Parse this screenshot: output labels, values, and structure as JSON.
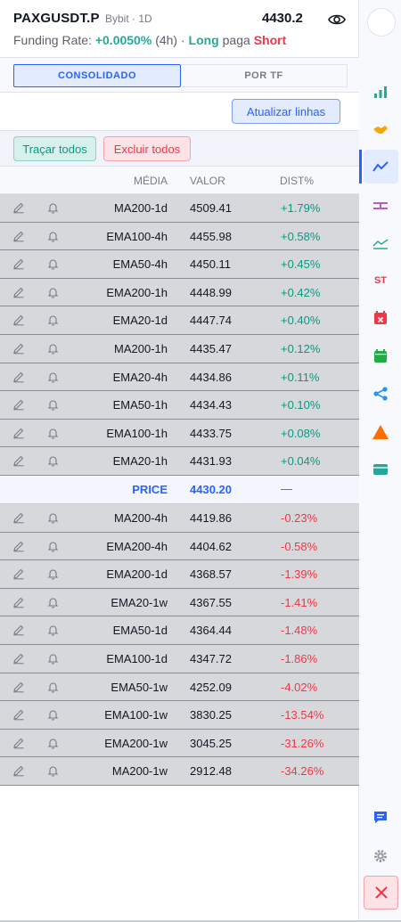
{
  "header": {
    "symbol": "PAXGUSDT.P",
    "exchange": "Bybit · 1D",
    "price": "4430.2",
    "funding_label": "Funding Rate:",
    "funding_rate": "+0.0050%",
    "funding_period": "(4h) ·",
    "long": "Long",
    "paga": "paga",
    "short": "Short"
  },
  "tabs": [
    {
      "label": "CONSOLIDADO",
      "active": true
    },
    {
      "label": "POR TF",
      "active": false
    }
  ],
  "buttons": {
    "update": "Atualizar linhas",
    "trace_all": "Traçar todos",
    "delete_all": "Excluir todos"
  },
  "table": {
    "headers": {
      "media": "MÉDIA",
      "valor": "VALOR",
      "dist": "DIST%"
    },
    "above": [
      {
        "name": "MA200-1d",
        "value": "4509.41",
        "dist": "+1.79%"
      },
      {
        "name": "EMA100-4h",
        "value": "4455.98",
        "dist": "+0.58%"
      },
      {
        "name": "EMA50-4h",
        "value": "4450.11",
        "dist": "+0.45%"
      },
      {
        "name": "EMA200-1h",
        "value": "4448.99",
        "dist": "+0.42%"
      },
      {
        "name": "EMA20-1d",
        "value": "4447.74",
        "dist": "+0.40%"
      },
      {
        "name": "MA200-1h",
        "value": "4435.47",
        "dist": "+0.12%"
      },
      {
        "name": "EMA20-4h",
        "value": "4434.86",
        "dist": "+0.11%"
      },
      {
        "name": "EMA50-1h",
        "value": "4434.43",
        "dist": "+0.10%"
      },
      {
        "name": "EMA100-1h",
        "value": "4433.75",
        "dist": "+0.08%"
      },
      {
        "name": "EMA20-1h",
        "value": "4431.93",
        "dist": "+0.04%"
      }
    ],
    "price_row": {
      "name": "PRICE",
      "value": "4430.20",
      "dist": "—"
    },
    "below": [
      {
        "name": "MA200-4h",
        "value": "4419.86",
        "dist": "-0.23%"
      },
      {
        "name": "EMA200-4h",
        "value": "4404.62",
        "dist": "-0.58%"
      },
      {
        "name": "EMA200-1d",
        "value": "4368.57",
        "dist": "-1.39%"
      },
      {
        "name": "EMA20-1w",
        "value": "4367.55",
        "dist": "-1.41%"
      },
      {
        "name": "EMA50-1d",
        "value": "4364.44",
        "dist": "-1.48%"
      },
      {
        "name": "EMA100-1d",
        "value": "4347.72",
        "dist": "-1.86%"
      },
      {
        "name": "EMA50-1w",
        "value": "4252.09",
        "dist": "-4.02%"
      },
      {
        "name": "EMA100-1w",
        "value": "3830.25",
        "dist": "-13.54%"
      },
      {
        "name": "EMA200-1w",
        "value": "3045.25",
        "dist": "-31.26%"
      },
      {
        "name": "MA200-1w",
        "value": "2912.48",
        "dist": "-34.26%"
      }
    ]
  },
  "rail": {
    "st_label": "ST",
    "icons": [
      "bar-chart-icon",
      "handshake-icon",
      "trend-line-icon",
      "horizontal-line-icon",
      "moving-average-icon",
      "st-icon",
      "calendar-x-icon",
      "calendar-icon",
      "share-icon",
      "warning-triangle-icon",
      "card-icon",
      "chat-icon",
      "settings-icon",
      "close-icon"
    ]
  },
  "colors": {
    "accent": "#2962ff",
    "positive": "#089981",
    "negative": "#f23645",
    "row_bg": "#d7d8dc"
  }
}
